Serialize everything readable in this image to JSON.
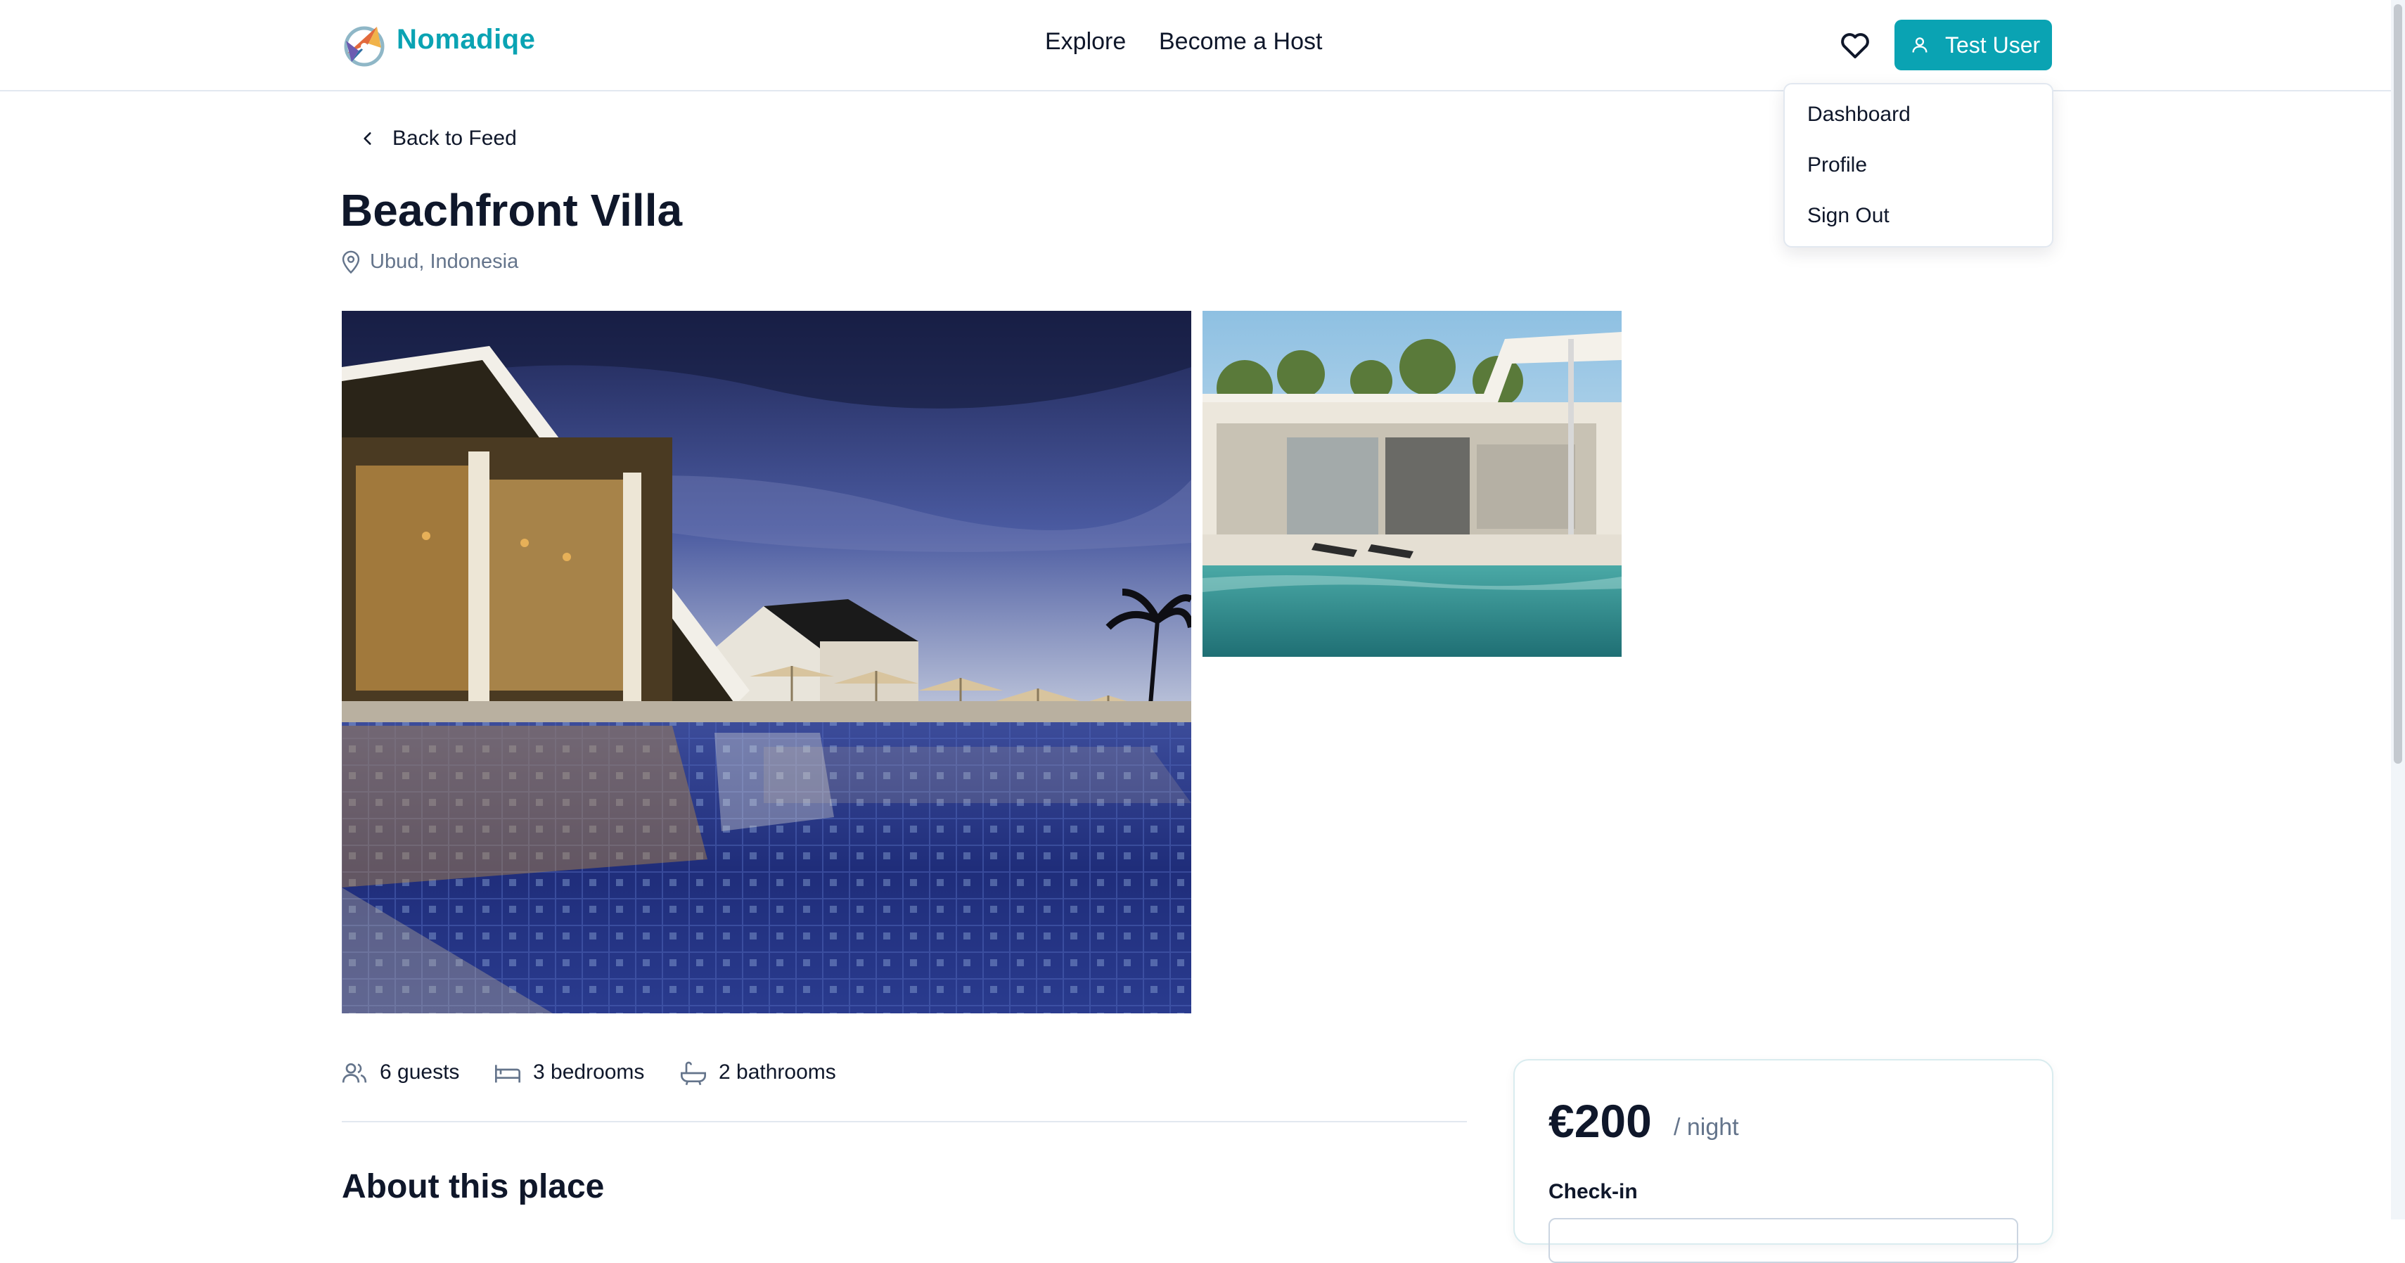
{
  "brand": {
    "name": "Nomadiqe",
    "accent_color": "#0aa3b3",
    "logo_icon": "compass-logo-icon"
  },
  "nav": {
    "explore": "Explore",
    "become_host": "Become a Host",
    "favorites_icon": "heart-icon",
    "user_label": "Test User",
    "user_icon": "user-icon"
  },
  "user_menu": {
    "items": [
      "Dashboard",
      "Profile",
      "Sign Out"
    ]
  },
  "page": {
    "back_label": "Back to Feed",
    "title": "Beachfront Villa",
    "location": "Ubud, Indonesia"
  },
  "amenities": [
    {
      "icon": "users-icon",
      "label": "6 guests"
    },
    {
      "icon": "bed-icon",
      "label": "3 bedrooms"
    },
    {
      "icon": "bath-icon",
      "label": "2 bathrooms"
    }
  ],
  "about": {
    "heading": "About this place"
  },
  "booking": {
    "price": "€200",
    "per_night": "/ night",
    "checkin_label": "Check-in"
  }
}
